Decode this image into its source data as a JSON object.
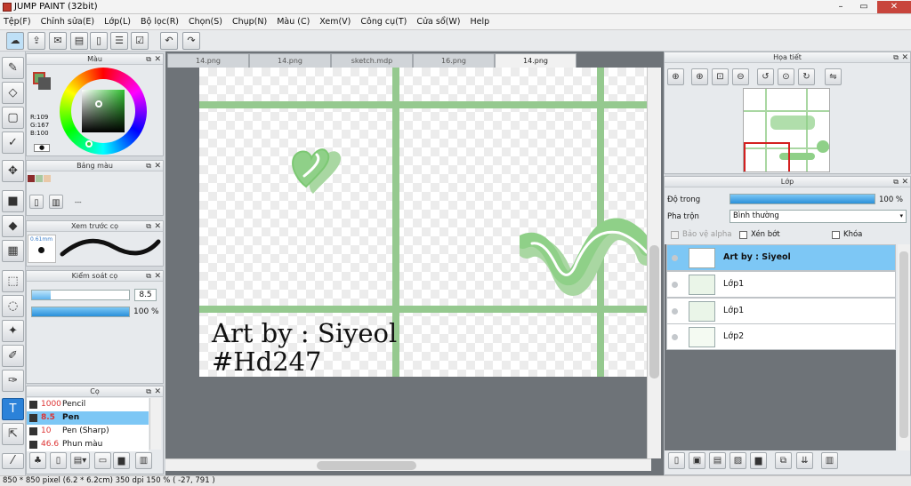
{
  "window": {
    "title": "JUMP PAINT (32bit)",
    "controls": [
      "–",
      "▭",
      "✕"
    ]
  },
  "menu": [
    "Tệp(F)",
    "Chỉnh sửa(E)",
    "Lớp(L)",
    "Bộ lọc(R)",
    "Chọn(S)",
    "Chụp(N)",
    "Màu (C)",
    "Xem(V)",
    "Công cụ(T)",
    "Cửa sổ(W)",
    "Help"
  ],
  "color_panel": {
    "title": "Màu",
    "rgb_r": "R:109",
    "rgb_g": "G:167",
    "rgb_b": "B:100",
    "main_color": "#6da764",
    "sub_color": "#555555"
  },
  "palette_panel": {
    "title": "Bảng màu",
    "swatches": [
      "#8b2c2c",
      "#c89080",
      "#e9c8a8"
    ],
    "more_label": "---"
  },
  "brush_preview_panel": {
    "title": "Xem trước cọ",
    "size_label": "0.61mm"
  },
  "brush_control_panel": {
    "title": "Kiểm soát cọ",
    "size_value": "8.5",
    "opacity_value": "100 %",
    "size_fraction": 0.19,
    "opacity_fraction": 1.0
  },
  "brush_panel": {
    "title": "Cọ",
    "items": [
      {
        "size": "1000",
        "name": "Pencil",
        "selected": false
      },
      {
        "size": "8.5",
        "name": "Pen",
        "selected": true
      },
      {
        "size": "10",
        "name": "Pen (Sharp)",
        "selected": false
      },
      {
        "size": "46.6",
        "name": "Phun màu",
        "selected": false
      }
    ]
  },
  "tabs": [
    {
      "label": "14.png",
      "active": false
    },
    {
      "label": "14.png",
      "active": false
    },
    {
      "label": "sketch.mdp",
      "active": false
    },
    {
      "label": "16.png",
      "active": false
    },
    {
      "label": "14.png",
      "active": true
    }
  ],
  "canvas": {
    "line1": "Art by : Siyeol",
    "line2": "#Hd247"
  },
  "navigator": {
    "title": "Họa tiết"
  },
  "layer_panel": {
    "title": "Lớp",
    "opacity_label": "Độ trong",
    "opacity_value": "100 %",
    "opacity_fraction": 1.0,
    "blend_label": "Pha trộn",
    "blend_value": "Bình thường",
    "protect_alpha": "Bảo vệ alpha",
    "clipping": "Xén bớt",
    "lock": "Khóa",
    "layers": [
      {
        "name": "Art by : Siyeol",
        "selected": true
      },
      {
        "name": "Lớp1",
        "selected": false
      },
      {
        "name": "Lớp1",
        "selected": false
      },
      {
        "name": "Lớp2",
        "selected": false
      }
    ]
  },
  "status": {
    "text": "850 * 850 pixel   (6.2 * 6.2cm)   350 dpi   150 %   ( -27, 791 )"
  }
}
